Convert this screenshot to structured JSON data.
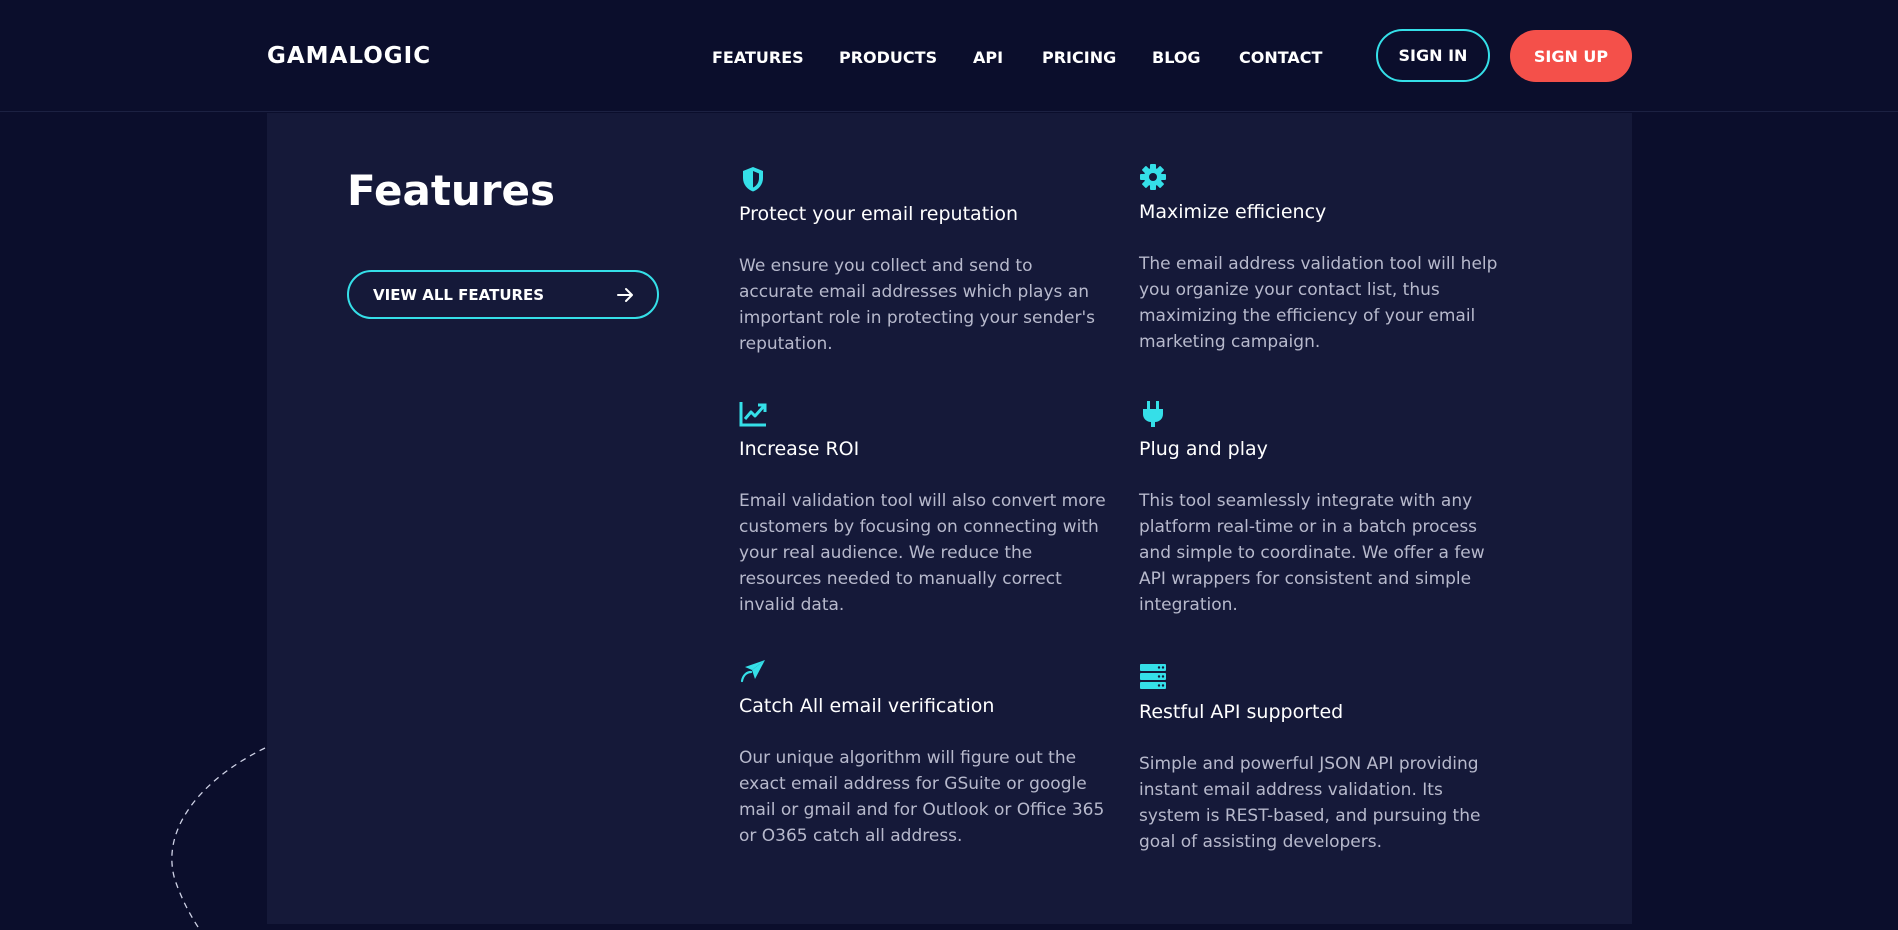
{
  "header": {
    "logo": "GAMALOGIC",
    "nav": [
      "FEATURES",
      "PRODUCTS",
      "API",
      "PRICING",
      "BLOG",
      "CONTACT"
    ],
    "sign_in": "SIGN IN",
    "sign_up": "SIGN UP"
  },
  "colors": {
    "background": "#0b0e2c",
    "panel": "#151939",
    "accent": "#35dfe8",
    "cta": "#f4504a",
    "body_text": "#b7b9cc"
  },
  "features_section": {
    "title": "Features",
    "view_all_label": "VIEW ALL FEATURES",
    "view_all_icon": "arrow-right-icon",
    "items": [
      {
        "icon": "shield-icon",
        "title": "Protect your email reputation",
        "description": "We ensure you collect and send to accurate email addresses which plays an important role in protecting your sender's reputation."
      },
      {
        "icon": "gear-icon",
        "title": "Maximize efficiency",
        "description": "The email address validation tool will help you organize your contact list, thus maximizing the efficiency of your email marketing campaign."
      },
      {
        "icon": "chart-line-icon",
        "title": "Increase ROI",
        "description": "Email validation tool will also convert more customers by focusing on connecting with your real audience. We reduce the resources needed to manually correct invalid data."
      },
      {
        "icon": "plug-icon",
        "title": "Plug and play",
        "description": "This tool seamlessly integrate with any platform real-time or in a batch process and simple to coordinate. We offer a few API wrappers for consistent and simple integration."
      },
      {
        "icon": "paper-plane-icon",
        "title": "Catch All email verification",
        "description": "Our unique algorithm will figure out the exact email address for GSuite or google mail or gmail and for Outlook or Office 365 or O365 catch all address."
      },
      {
        "icon": "server-icon",
        "title": "Restful API supported",
        "description": "Simple and powerful JSON API providing instant email address validation. Its system is REST-based, and pursuing the goal of assisting developers."
      }
    ]
  }
}
